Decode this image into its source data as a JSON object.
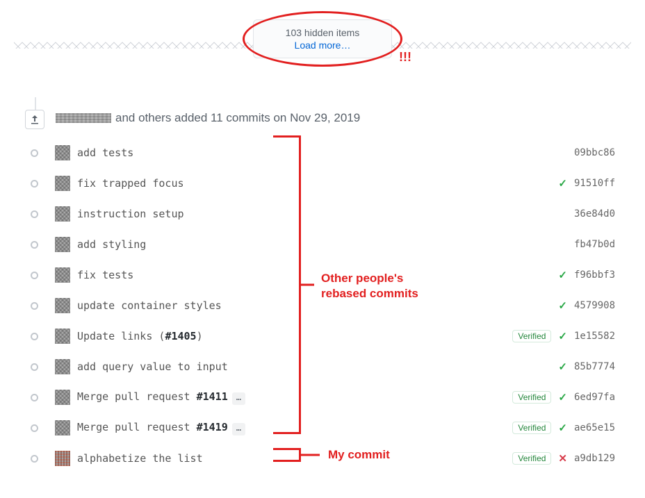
{
  "expander": {
    "count_text": "103 hidden items",
    "load_text": "Load more…"
  },
  "annotations": {
    "bangs": "!!!",
    "others_line1": "Other people's",
    "others_line2": "rebased commits",
    "mine": "My commit"
  },
  "summary": {
    "suffix": "and others added 11 commits",
    "date": "on Nov 29, 2019"
  },
  "commits": [
    {
      "msg_pre": "add tests",
      "pr": "",
      "ellipsis": false,
      "verified": false,
      "check": false,
      "cross": false,
      "sha": "09bbc86",
      "avatar": "def"
    },
    {
      "msg_pre": "fix trapped focus",
      "pr": "",
      "ellipsis": false,
      "verified": false,
      "check": true,
      "cross": false,
      "sha": "91510ff",
      "avatar": "def"
    },
    {
      "msg_pre": "instruction setup",
      "pr": "",
      "ellipsis": false,
      "verified": false,
      "check": false,
      "cross": false,
      "sha": "36e84d0",
      "avatar": "def"
    },
    {
      "msg_pre": "add styling",
      "pr": "",
      "ellipsis": false,
      "verified": false,
      "check": false,
      "cross": false,
      "sha": "fb47b0d",
      "avatar": "def"
    },
    {
      "msg_pre": "fix tests",
      "pr": "",
      "ellipsis": false,
      "verified": false,
      "check": true,
      "cross": false,
      "sha": "f96bbf3",
      "avatar": "def"
    },
    {
      "msg_pre": "update container styles",
      "pr": "",
      "ellipsis": false,
      "verified": false,
      "check": true,
      "cross": false,
      "sha": "4579908",
      "avatar": "def"
    },
    {
      "msg_pre": "Update links (",
      "pr": "#1405",
      "msg_post": ")",
      "ellipsis": false,
      "verified": true,
      "check": true,
      "cross": false,
      "sha": "1e15582",
      "avatar": "def"
    },
    {
      "msg_pre": "add query value to input",
      "pr": "",
      "ellipsis": false,
      "verified": false,
      "check": true,
      "cross": false,
      "sha": "85b7774",
      "avatar": "def"
    },
    {
      "msg_pre": "Merge pull request ",
      "pr": "#1411",
      "msg_post": "",
      "ellipsis": true,
      "verified": true,
      "check": true,
      "cross": false,
      "sha": "6ed97fa",
      "avatar": "def"
    },
    {
      "msg_pre": "Merge pull request ",
      "pr": "#1419",
      "msg_post": "",
      "ellipsis": true,
      "verified": true,
      "check": true,
      "cross": false,
      "sha": "ae65e15",
      "avatar": "def"
    },
    {
      "msg_pre": "alphabetize the list",
      "pr": "",
      "ellipsis": false,
      "verified": true,
      "check": false,
      "cross": true,
      "sha": "a9db129",
      "avatar": "last"
    }
  ],
  "verified_label": "Verified",
  "ellipsis_label": "…"
}
